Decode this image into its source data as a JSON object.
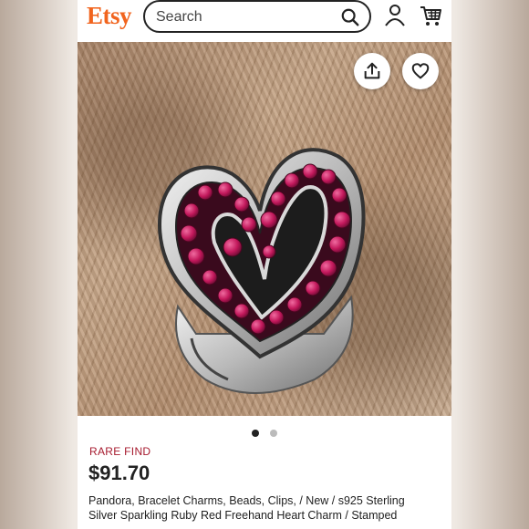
{
  "header": {
    "logo": "Etsy",
    "search_placeholder": "Search",
    "icons": [
      "search-icon",
      "account-icon",
      "cart-icon"
    ]
  },
  "product": {
    "image_alt_icons": [
      "share-icon",
      "heart-outline-icon"
    ],
    "carousel": {
      "total": 2,
      "active": 1
    },
    "badge": "RARE FIND",
    "price": "$91.70",
    "title_line1": "Pandora, Bracelet Charms, Beads, Clips, / New / s925 Sterling",
    "title_line2": "Silver Sparkling Ruby Red Freehand Heart Charm / Stamped"
  },
  "colors": {
    "brand": "#f1641e",
    "badge": "#a61a2e",
    "gem": "#c2185b"
  }
}
